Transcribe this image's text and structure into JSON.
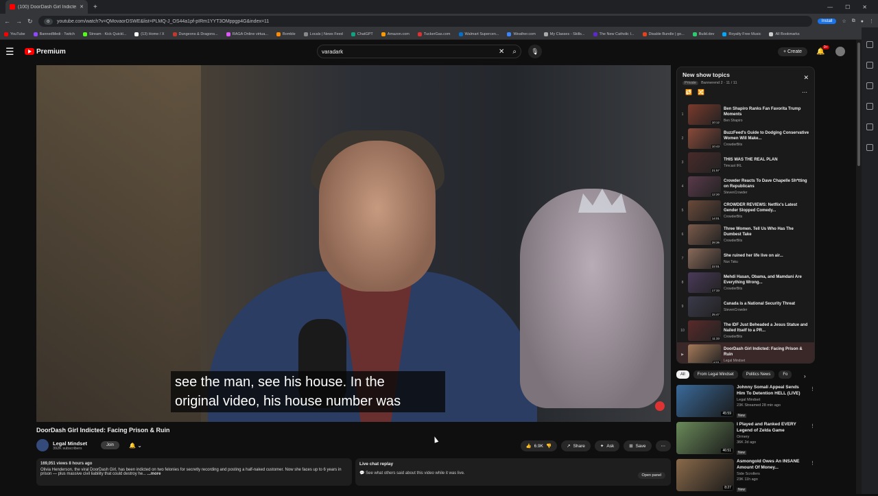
{
  "browser": {
    "tab_title": "(100) DoorDash Girl Indicte...",
    "url": "youtube.com/watch?v=QMovaorDSWE&list=PLMQ-J_OS44a1pf-pIRm1YYT3OMppgp4G&index=11",
    "install_label": "Install",
    "bookmarks": [
      "YouTube",
      "BannedMedi · Twitch",
      "Stream · Kick Quickl...",
      "(13) Home / X",
      "Dungeons & Dragons...",
      "RAGA Online virtua...",
      "Bomble",
      "Locals | News Feed",
      "ChatGPT",
      "Amazon.com",
      "TuckerGas.com",
      "Walmart Supercen...",
      "Weather.com",
      "My Classes - Skills...",
      "The New Catholic I...",
      "Disable Bundle | go...",
      "Build.dev",
      "Royalty Free Music",
      "All Bookmarks"
    ]
  },
  "header": {
    "logo_text": "Premium",
    "search_value": "varadark",
    "create_label": "Create",
    "notif_count": "9+"
  },
  "video": {
    "caption_line1": "see the man, see his house. In the",
    "caption_line2": "original video, his house number was",
    "title": "DoorDash Girl Indicted: Facing Prison & Ruin",
    "channel": "Legal Mindset",
    "subscribers": "392K subscribers",
    "join_label": "Join",
    "likes": "6.9K",
    "share_label": "Share",
    "ask_label": "Ask",
    "save_label": "Save",
    "desc_meta": "169,051 views  8 hours ago",
    "desc_text": "Olivia Henderson, the viral DoorDash Girl, has been indicted on two felonies for secretly recording and posting a half-naked customer. Now she faces up to 6 years in prison — plus massive civil liability that could destroy he...",
    "desc_more": "...more",
    "livechat_title": "Live chat replay",
    "livechat_sub": "See what others said about this video while it was live.",
    "open_panel": "Open panel"
  },
  "playlist": {
    "title": "New show topics",
    "privacy": "Private",
    "owner": "Bannerend 2 · 11 / 11",
    "items": [
      {
        "idx": "1",
        "title": "Ben Shapiro Ranks Fan Favorita Trump Moments",
        "channel": "Ben Shapiro",
        "dur": "10:12",
        "color": "#7a3a2c"
      },
      {
        "idx": "2",
        "title": "BuzzFeed's Guide to Dodging Conservative Women Will Make...",
        "channel": "CrowderBits",
        "dur": "10:43",
        "color": "#8a4a3a"
      },
      {
        "idx": "3",
        "title": "THIS WAS THE REAL PLAN",
        "channel": "Timcast IRL",
        "dur": "21:57",
        "color": "#4a2a2a"
      },
      {
        "idx": "4",
        "title": "Crowder Reacts To Dave Chapelle Sh*tting on Republicans",
        "channel": "StevenCrowder",
        "dur": "12:20",
        "color": "#5a3a4a"
      },
      {
        "idx": "5",
        "title": "CROWDER REVIEWS: Netflix's Latest Gender Slopped Comedy...",
        "channel": "CrowderBits",
        "dur": "14:01",
        "color": "#6a4a3a"
      },
      {
        "idx": "6",
        "title": "Three Women. Tell Us Who Has The Dumbest Take",
        "channel": "CrowderBits",
        "dur": "28:36",
        "color": "#7a5a4a"
      },
      {
        "idx": "7",
        "title": "She ruined her life live on air...",
        "channel": "Nux Taku",
        "dur": "22:01",
        "color": "#8a6a5a"
      },
      {
        "idx": "8",
        "title": "Mehdi Hasan, Obama, and Mamdani Are Everything Wrong...",
        "channel": "CrowderBits",
        "dur": "17:33",
        "color": "#4a3a5a"
      },
      {
        "idx": "9",
        "title": "Canada is a National Security Threat",
        "channel": "StevenCrowder",
        "dur": "25:47",
        "color": "#3a3a4a"
      },
      {
        "idx": "10",
        "title": "The IDF Just Beheaded a Jesus Statue and Nailed Itself to a PR...",
        "channel": "CrowderBits",
        "dur": "11:33",
        "color": "#5a2a2a"
      },
      {
        "idx": "▶",
        "title": "DoorDash Girl Indicted: Facing Prison & Ruin",
        "channel": "Legal Mindset",
        "dur": "8:01",
        "color": "#a57a5a"
      }
    ]
  },
  "chips": [
    "All",
    "From Legal Mindset",
    "Politics News",
    "Fo"
  ],
  "recommendations": [
    {
      "title": "Johnny Somali Appeal Sends Him To Detention HELL (LIVE)",
      "channel": "Legal Mindset",
      "meta": "23K  Streamed 28 min ago",
      "badge": "New",
      "dur": "45:59",
      "color": "#3a6a9a"
    },
    {
      "title": "I Played and Ranked EVERY Legend of Zelda Game",
      "channel": "Ormery",
      "meta": "36K  2d ago",
      "badge": "New",
      "dur": "46:51",
      "color": "#6a8a5a"
    },
    {
      "title": "Asmongold Owes An INSANE Amount Of Money...",
      "channel": "Side Scrollers",
      "meta": "23K  11h ago",
      "badge": "New",
      "dur": "8:27",
      "color": "#8a6a4a"
    }
  ]
}
